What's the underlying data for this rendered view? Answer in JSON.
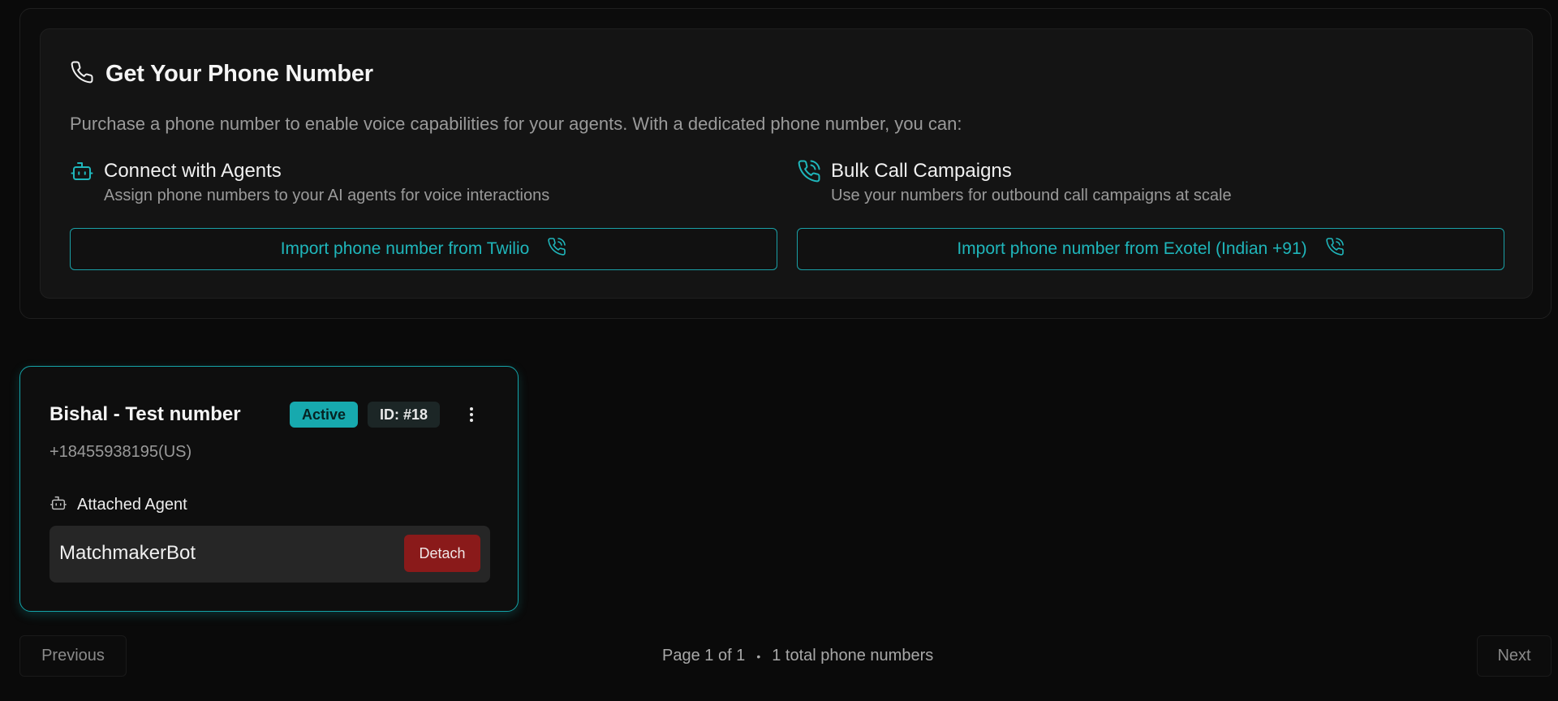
{
  "hero": {
    "title": "Get Your Phone Number",
    "title_icon": "phone-icon",
    "description": "Purchase a phone number to enable voice capabilities for your agents. With a dedicated phone number, you can:",
    "features": [
      {
        "icon": "bot-icon",
        "title": "Connect with Agents",
        "subtitle": "Assign phone numbers to your AI agents for voice interactions"
      },
      {
        "icon": "phone-call-icon",
        "title": "Bulk Call Campaigns",
        "subtitle": "Use your numbers for outbound call campaigns at scale"
      }
    ],
    "import_twilio_label": "Import phone number from Twilio",
    "import_exotel_label": "Import phone number from Exotel (Indian +91)"
  },
  "phone_card": {
    "name": "Bishal - Test number",
    "status": "Active",
    "id_label": "ID: #18",
    "number": "+18455938195(US)",
    "attached_label": "Attached Agent",
    "agent_name": "MatchmakerBot",
    "detach_label": "Detach"
  },
  "pagination": {
    "previous_label": "Previous",
    "next_label": "Next",
    "page_text": "Page 1 of 1",
    "separator": "•",
    "total_text": "1 total phone numbers"
  },
  "colors": {
    "accent": "#1fb6bb",
    "danger": "#8a1a1a",
    "background": "#0a0a0a"
  }
}
